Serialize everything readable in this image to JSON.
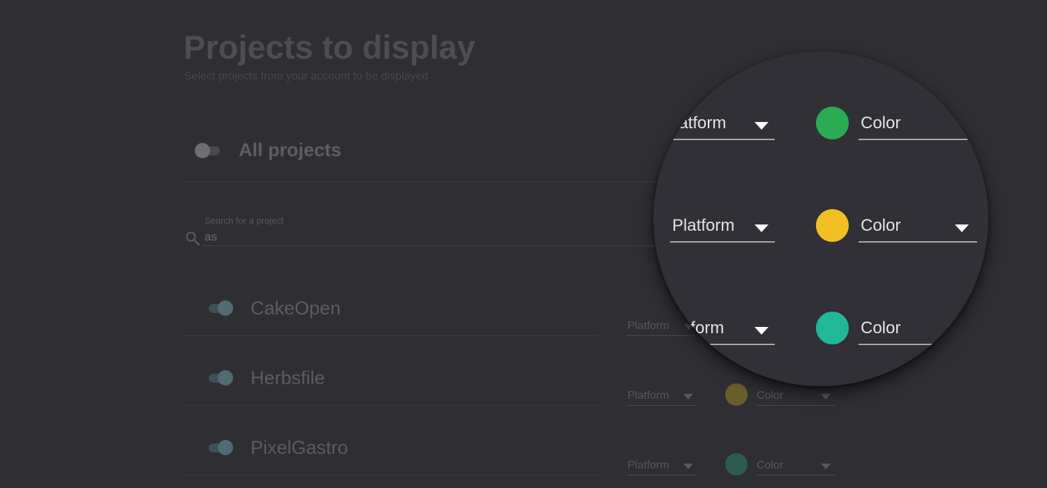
{
  "header": {
    "title": "Projects to display",
    "subtitle": "Select projects from your account to be displayed"
  },
  "all_projects": {
    "label": "All projects",
    "enabled": false
  },
  "search": {
    "label": "Search for a project",
    "value": "as"
  },
  "projects": [
    {
      "name": "CakeOpen",
      "enabled": true,
      "platform": "Platform",
      "color_label": "Color",
      "color": "#2bab54"
    },
    {
      "name": "Herbsfile",
      "enabled": true,
      "platform": "Platform",
      "color_label": "Color",
      "color": "#f0c024"
    },
    {
      "name": "PixelGastro",
      "enabled": true,
      "platform": "Platform",
      "color_label": "Color",
      "color": "#22b798"
    }
  ],
  "magnifier": {
    "rows": [
      {
        "platform": "Platform",
        "color_label": "Color",
        "color": "#2bab54"
      },
      {
        "platform": "Platform",
        "color_label": "Color",
        "color": "#f0c024"
      },
      {
        "platform": "Platform",
        "color_label": "Color",
        "color": "#22b798"
      }
    ]
  },
  "colors": {
    "background": "#2f2e33",
    "green": "#2bab54",
    "yellow": "#f0c024",
    "teal": "#22b798"
  }
}
